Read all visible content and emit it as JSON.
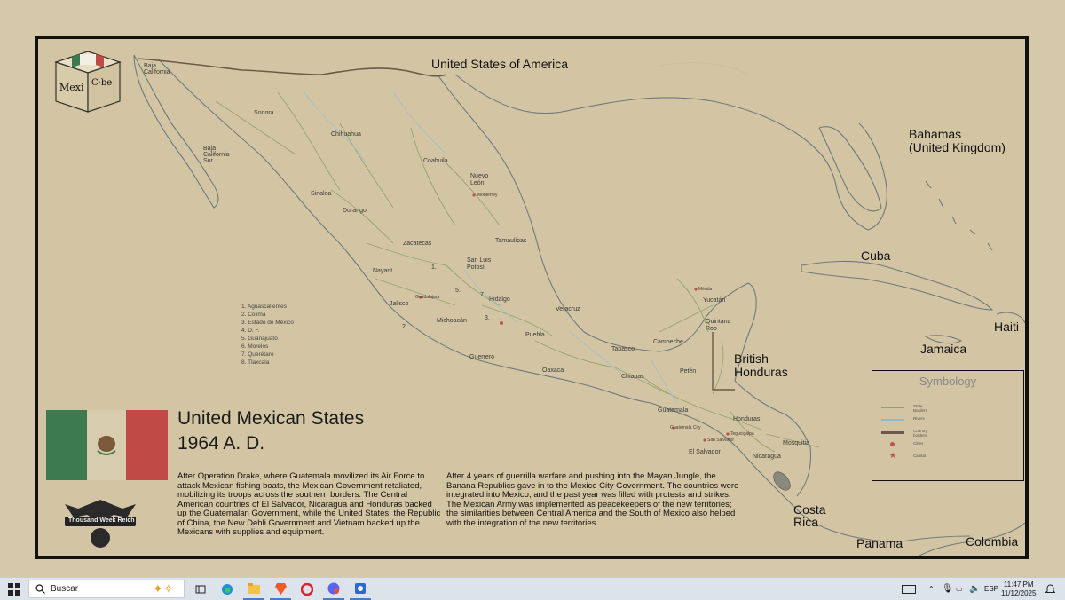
{
  "map": {
    "countries": {
      "usa": "United States of America",
      "bahamas": "Bahamas\n(United Kingdom)",
      "cuba": "Cuba",
      "haiti": "Haiti",
      "jamaica": "Jamaica",
      "british_honduras": "British\nHonduras",
      "costa_rica": "Costa\nRica",
      "panama": "Panama",
      "colombia": "Colombia"
    },
    "states": {
      "baja_california": "Baja\nCalifornia",
      "sonora": "Sonora",
      "chihuahua": "Chihuahua",
      "baja_california_sur": "Baja\nCalifornia\nSur",
      "coahuila": "Coahuila",
      "nuevo_leon": "Nuevo\nLeón",
      "sinaloa": "Sinaloa",
      "durango": "Durango",
      "tamaulipas": "Tamaulipas",
      "zacatecas": "Zacatecas",
      "san_luis_potosi": "San Luis\nPotosí",
      "nayarit": "Nayarit",
      "jalisco": "Jalisco",
      "hidalgo": "Hidalgo",
      "veracruz": "Veracruz",
      "michoacan": "Michoacán",
      "guerrero": "Guerrero",
      "puebla": "Puebla",
      "oaxaca": "Oaxaca",
      "tabasco": "Tabasco",
      "campeche": "Campeche",
      "yucatan": "Yucatán",
      "quintana_roo": "Quintana\nRoo",
      "chiapas": "Chiapas",
      "peten": "Petén",
      "guatemala": "Guatemala",
      "honduras": "Honduras",
      "el_salvador": "El Salvador",
      "nicaragua": "Nicaragua",
      "mosquitia": "Mosquitia"
    },
    "cities": {
      "monterrey": "Monterrey",
      "guadalajara": "Guadalajara",
      "merida": "Mérida",
      "tegucigalpa": "Tegucigalpa",
      "san_salvador": "San Salvador",
      "guatemala_city": "Guatemala City"
    },
    "numbers": {
      "n1": "1.",
      "n2": "2.",
      "n3": "3.",
      "n5": "5.",
      "n7": "7."
    },
    "numbered_legend": [
      "1. Aguascalientes",
      "2. Colima",
      "3. Estado de México",
      "4. D. F.",
      "5. Guanajuato",
      "6. Morelos",
      "7. Querétaro",
      "8. Tlaxcala"
    ],
    "title_line1": "United Mexican States",
    "title_line2": "1964 A. D.",
    "paragraph_left": "After Operation Drake, where Guatemala movilized its Air Force to attack Mexican fishing boats, the Mexican Government retaliated, mobilizing its troops across the southern borders. The Central American countries of El Salvador, Nicaragua and Honduras backed up the Guatemalan Government, while the United States, the Republic of China, the New Dehli Government and Vietnam backed up the Mexicans with supplies and equipment.",
    "paragraph_right": "After 4 years of guerrilla warfare and pushing into the Mayan Jungle, the Banana Republics gave in to the Mexico City Government. The countries were integrated into Mexico, and the past year was filled with protests and strikes. The Mexican Army was implemented as peacekeepers of the new territories; the similarities between Central America and the South of Mexico also helped with the integration of the new territories.",
    "symbology": {
      "title": "Symbology",
      "items": [
        {
          "label": "State Borders",
          "color": "#8fa36a"
        },
        {
          "label": "Rivers",
          "color": "#8fb7c9"
        },
        {
          "label": "Country borders",
          "color": "#6a5a4a"
        },
        {
          "label": "Cities",
          "color": "#c0504d"
        },
        {
          "label": "Capital",
          "color": "#c0504d"
        }
      ]
    },
    "logo_text": {
      "mexi": "Mexi",
      "cube": "C·be"
    },
    "emblem_text": "Thousand Week Reich",
    "colors": {
      "land": "#d3c5a3",
      "sea": "#d3c5a3",
      "coast": "#6f7a7e",
      "state_border": "#8fa36a",
      "river": "#9fbfcc",
      "flag_green": "#3d7a4f",
      "flag_red": "#c04a45"
    }
  },
  "taskbar": {
    "search_placeholder": "Buscar",
    "language": "ESP",
    "time": "11:47 PM",
    "date": "11/12/2025"
  }
}
